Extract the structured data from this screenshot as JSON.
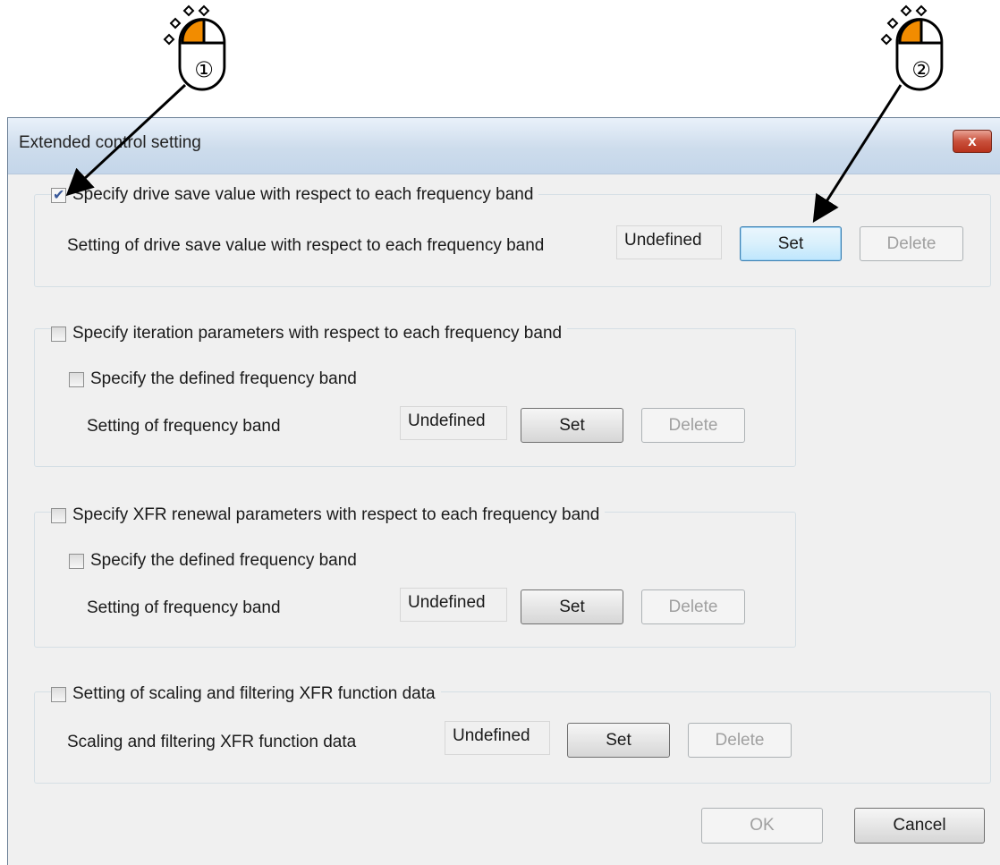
{
  "dialog": {
    "title": "Extended control setting",
    "close_label": "x"
  },
  "annotations": {
    "marker1_label": "①",
    "marker2_label": "②"
  },
  "section_drive": {
    "checkbox_label": "Specify drive save value with respect to each frequency band",
    "checked": true,
    "setting_label": "Setting of drive save value with respect to each frequency band",
    "value": "Undefined",
    "set_label": "Set",
    "delete_label": "Delete"
  },
  "section_iteration": {
    "checkbox_label": "Specify iteration parameters with respect to each frequency band",
    "checked": false,
    "sub_checkbox_label": "Specify the defined frequency band",
    "setting_label": "Setting of frequency band",
    "value": "Undefined",
    "set_label": "Set",
    "delete_label": "Delete"
  },
  "section_xfr": {
    "checkbox_label": "Specify XFR renewal parameters with respect to each frequency band",
    "checked": false,
    "sub_checkbox_label": "Specify the defined frequency band",
    "setting_label": "Setting of frequency band",
    "value": "Undefined",
    "set_label": "Set",
    "delete_label": "Delete"
  },
  "section_scaling": {
    "checkbox_label": "Setting of scaling and filtering XFR function data",
    "checked": false,
    "setting_label": "Scaling and filtering XFR function data",
    "value": "Undefined",
    "set_label": "Set",
    "delete_label": "Delete"
  },
  "footer": {
    "ok_label": "OK",
    "cancel_label": "Cancel"
  },
  "colors": {
    "mouse_button_highlight": "#f28c00",
    "focus_border": "#3c7fb1"
  }
}
